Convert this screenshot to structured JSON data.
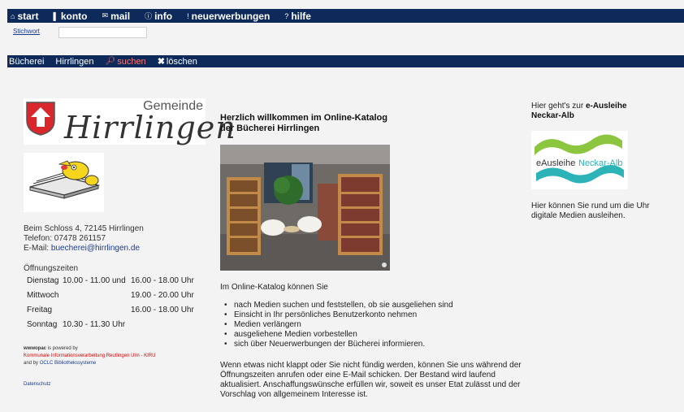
{
  "topnav": {
    "items": [
      {
        "icon": "home-icon",
        "glyph": "⌂",
        "label": "start"
      },
      {
        "icon": "account-icon",
        "glyph": "▌",
        "label": "konto"
      },
      {
        "icon": "mail-icon",
        "glyph": "✉",
        "label": "mail"
      },
      {
        "icon": "info-icon",
        "glyph": "ⓘ",
        "label": "info"
      },
      {
        "icon": "new-items-icon",
        "glyph": "!",
        "label": "neuerwerbungen"
      },
      {
        "icon": "help-icon",
        "glyph": "?",
        "label": "hilfe"
      }
    ]
  },
  "search": {
    "label": "Stichwort",
    "value": "",
    "placeholder": ""
  },
  "secnav": {
    "library": "Bücherei",
    "place": "Hirrlingen",
    "search": "suchen",
    "clear": "löschen"
  },
  "logo": {
    "gemeinde": "Gemeinde",
    "name": "Hirrlingen"
  },
  "contact": {
    "address": "Beim Schloss 4, 72145 Hirrlingen",
    "phone": "Telefon: 07478 261157",
    "email_label": "E-Mail:",
    "email": "buecherei@hirrlingen.de"
  },
  "hours": {
    "title": "Öffnungszeiten",
    "rows": [
      {
        "day": "Dienstag",
        "t1": "10.00 - 11.00 und",
        "t2": "16.00 - 18.00 Uhr"
      },
      {
        "day": "Mittwoch",
        "t1": "",
        "t2": "19.00 - 20.00 Uhr"
      },
      {
        "day": "Freitag",
        "t1": "",
        "t2": "16.00 - 18.00 Uhr"
      },
      {
        "day": "Sonntag",
        "t1": "10.30 - 11.30 Uhr",
        "t2": ""
      }
    ]
  },
  "powered": {
    "line1_bold": "wwwopac",
    "line1_rest": " is powered by",
    "line2": "Kommunale Informationsverarbeitung Reutlingen Ulm - KIRU",
    "line3_pre": "and by ",
    "line3_link": "OCLC Bibliothekssysteme",
    "datenschutz": "Datenschutz"
  },
  "welcome": {
    "line1": "Herzlich willkommen im Online-Katalog",
    "line2": "der Bücherei Hirrlingen"
  },
  "intro": "Im Online-Katalog können Sie",
  "bullets": [
    "nach Medien suchen und feststellen, ob sie ausgeliehen sind",
    "Einsicht in Ihr persönliches Benutzerkonto nehmen",
    "Medien verlängern",
    "ausgeliehene Medien vorbestellen",
    "sich über Neuerwerbungen der Bücherei informieren."
  ],
  "paragraph": "Wenn etwas nicht klappt oder Sie nicht fündig werden, können Sie uns während der Öffnungszeiten anrufen oder eine E-Mail schicken. Der Bestand wird laufend aktualisiert. Anschaffungswünsche erfüllen wir, soweit es unser Etat zulässt und der Vorschlag von allgemeinem Interesse ist.",
  "right": {
    "intro": "Hier geht's zur ",
    "bold1": "e-Ausleihe",
    "bold2": "Neckar-Alb",
    "logo_text_a": "eAusleihe",
    "logo_text_b": "Neckar-Alb",
    "text": "Hier können Sie rund um die Uhr digitale Medien ausleihen."
  },
  "colors": {
    "nav": "#0d2a5a",
    "link": "#1a3b8f",
    "suchen": "#ff7676",
    "eausleihe_green": "#8cc63f",
    "eausleihe_teal": "#2bb3b8"
  }
}
